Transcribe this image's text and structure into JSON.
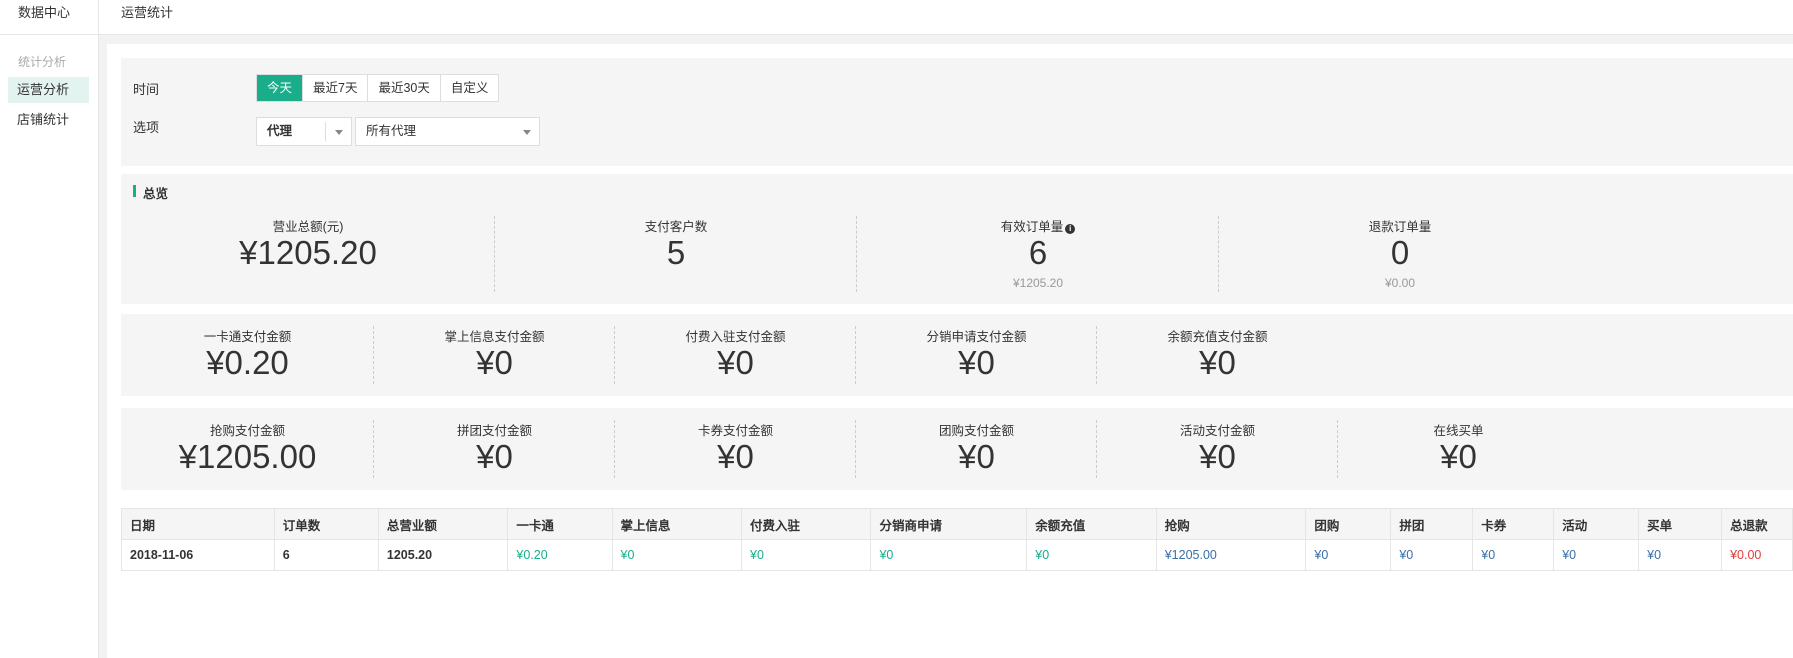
{
  "topbar": {
    "brand": "数据中心",
    "breadcrumb": "运营统计"
  },
  "sidebar": {
    "group_label": "统计分析",
    "items": [
      {
        "label": "运营分析",
        "active": true
      },
      {
        "label": "店铺统计",
        "active": false
      }
    ]
  },
  "filter": {
    "time_label": "时间",
    "time_options": [
      {
        "label": "今天",
        "active": true
      },
      {
        "label": "最近7天",
        "active": false
      },
      {
        "label": "最近30天",
        "active": false
      },
      {
        "label": "自定义",
        "active": false
      }
    ],
    "option_label": "选项",
    "option_select": "代理",
    "agent_select": "所有代理"
  },
  "overview": {
    "title": "总览"
  },
  "stats_row1": [
    {
      "label": "营业总额(元)",
      "value": "¥1205.20",
      "sub": ""
    },
    {
      "label": "支付客户数",
      "value": "5",
      "sub": ""
    },
    {
      "label": "有效订单量",
      "value": "6",
      "sub": "¥1205.20",
      "info": true
    },
    {
      "label": "退款订单量",
      "value": "0",
      "sub": "¥0.00"
    }
  ],
  "stats_row2": [
    {
      "label": "一卡通支付金额",
      "value": "¥0.20"
    },
    {
      "label": "掌上信息支付金额",
      "value": "¥0"
    },
    {
      "label": "付费入驻支付金额",
      "value": "¥0"
    },
    {
      "label": "分销申请支付金额",
      "value": "¥0"
    },
    {
      "label": "余额充值支付金额",
      "value": "¥0"
    }
  ],
  "stats_row3": [
    {
      "label": "抢购支付金额",
      "value": "¥1205.00"
    },
    {
      "label": "拼团支付金额",
      "value": "¥0"
    },
    {
      "label": "卡券支付金额",
      "value": "¥0"
    },
    {
      "label": "团购支付金额",
      "value": "¥0"
    },
    {
      "label": "活动支付金额",
      "value": "¥0"
    },
    {
      "label": "在线买单",
      "value": "¥0"
    }
  ],
  "table": {
    "headers": [
      "日期",
      "订单数",
      "总营业额",
      "一卡通",
      "掌上信息",
      "付费入驻",
      "分销商申请",
      "余额充值",
      "抢购",
      "团购",
      "拼团",
      "卡券",
      "活动",
      "买单",
      "总退款"
    ],
    "rows": [
      [
        "2018-11-06",
        "6",
        "1205.20",
        "¥0.20",
        "¥0",
        "¥0",
        "¥0",
        "¥0",
        "¥1205.00",
        "¥0",
        "¥0",
        "¥0",
        "¥0",
        "¥0",
        "¥0.00"
      ]
    ]
  },
  "colors": {
    "accent": "#1aad8a",
    "link_blue": "#3a6fa8",
    "refund_red": "#e23c3c"
  }
}
